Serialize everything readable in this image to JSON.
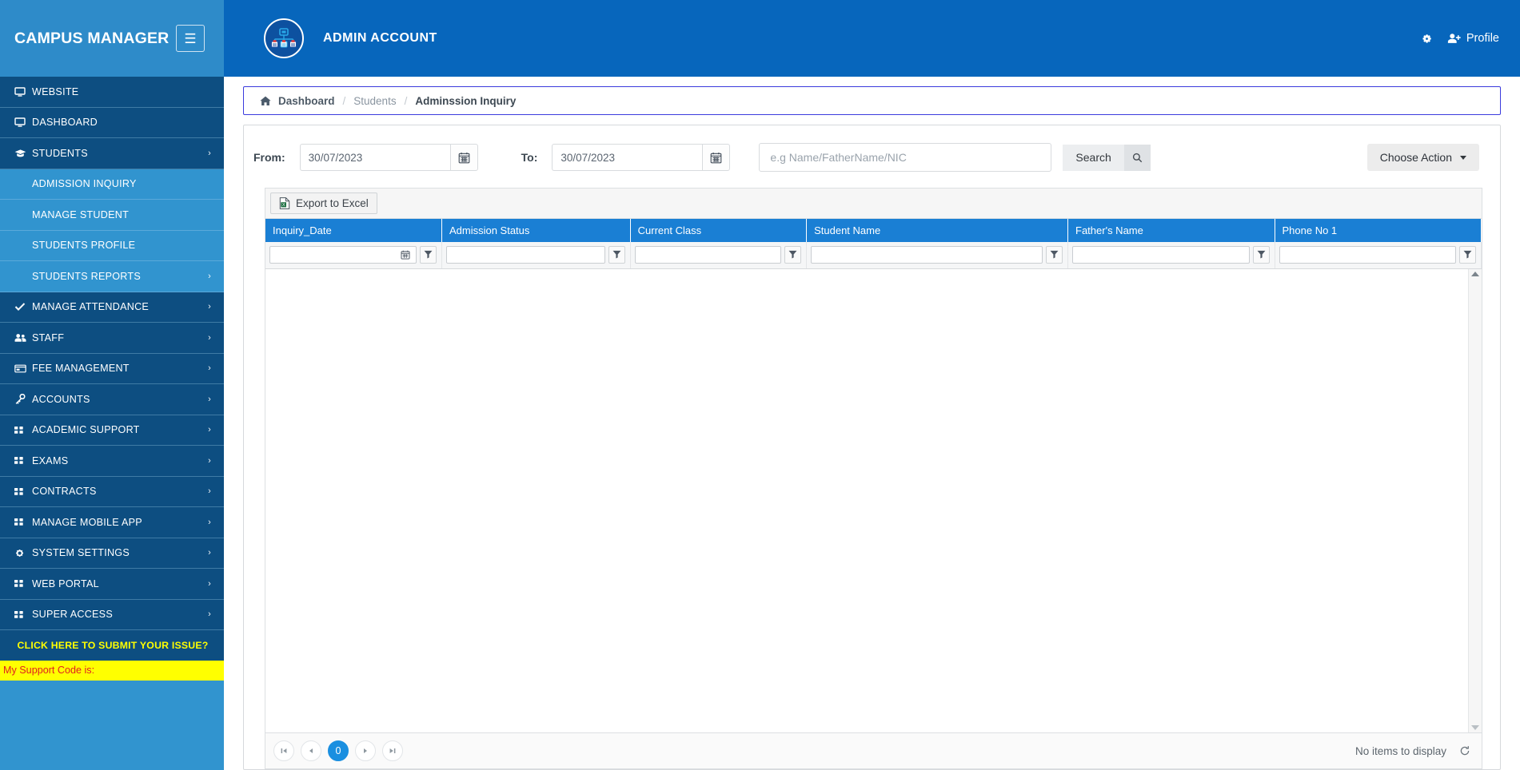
{
  "brand": {
    "title": "CAMPUS MANAGER",
    "menu_icon": "hamburger-icon"
  },
  "sidebar": {
    "items": [
      {
        "label": "WEBSITE",
        "icon": "monitor-icon",
        "caret": "",
        "level": "top"
      },
      {
        "label": "DASHBOARD",
        "icon": "monitor-icon",
        "caret": "",
        "level": "top"
      },
      {
        "label": "STUDENTS",
        "icon": "graduation-cap-icon",
        "caret": "›",
        "level": "top"
      },
      {
        "label": "ADMISSION INQUIRY",
        "icon": "",
        "caret": "",
        "level": "sub"
      },
      {
        "label": "MANAGE STUDENT",
        "icon": "",
        "caret": "",
        "level": "sub"
      },
      {
        "label": "STUDENTS PROFILE",
        "icon": "",
        "caret": "",
        "level": "sub"
      },
      {
        "label": "STUDENTS REPORTS",
        "icon": "",
        "caret": "›",
        "level": "sub"
      },
      {
        "label": "MANAGE ATTENDANCE",
        "icon": "check-icon",
        "caret": "›",
        "level": "top"
      },
      {
        "label": "STAFF",
        "icon": "users-icon",
        "caret": "›",
        "level": "top"
      },
      {
        "label": "FEE MANAGEMENT",
        "icon": "credit-card-icon",
        "caret": "›",
        "level": "top"
      },
      {
        "label": "ACCOUNTS",
        "icon": "key-icon",
        "caret": "›",
        "level": "top"
      },
      {
        "label": "ACADEMIC SUPPORT",
        "icon": "grid-icon",
        "caret": "›",
        "level": "top"
      },
      {
        "label": "EXAMS",
        "icon": "grid-icon",
        "caret": "›",
        "level": "top"
      },
      {
        "label": "CONTRACTS",
        "icon": "grid-icon",
        "caret": "›",
        "level": "top"
      },
      {
        "label": "MANAGE MOBILE APP",
        "icon": "grid-icon",
        "caret": "›",
        "level": "top"
      },
      {
        "label": "SYSTEM SETTINGS",
        "icon": "gear-icon",
        "caret": "›",
        "level": "top"
      },
      {
        "label": "WEB PORTAL",
        "icon": "grid-icon",
        "caret": "›",
        "level": "top"
      },
      {
        "label": "SUPER ACCESS",
        "icon": "grid-icon",
        "caret": "›",
        "level": "top"
      }
    ],
    "issue_link": "CLICK HERE TO SUBMIT YOUR ISSUE?",
    "support_code": "My Support Code is:"
  },
  "topbar": {
    "logo_icon": "org-chart-badge-icon",
    "account_title": "ADMIN ACCOUNT",
    "settings_icon": "gear-icon",
    "profile_icon": "user-plus-icon",
    "profile_label": "Profile"
  },
  "breadcrumb": {
    "home_icon": "home-icon",
    "item1": "Dashboard",
    "sep1": "/",
    "item2": "Students",
    "sep2": "/",
    "item3": "Adminssion Inquiry"
  },
  "filters": {
    "from_label": "From:",
    "from_value": "30/07/2023",
    "to_label": "To:",
    "to_value": "30/07/2023",
    "calendar_icon": "calendar-icon",
    "search_placeholder": "e.g Name/FatherName/NIC",
    "search_value": "",
    "search_label": "Search",
    "search_icon": "magnifier-icon",
    "choose_action_label": "Choose Action",
    "choose_action_caret": "chevron-down-icon"
  },
  "grid": {
    "export_label": "Export to Excel",
    "export_icon": "excel-file-icon",
    "filter_icon": "funnel-icon",
    "columns": [
      {
        "label": "Inquiry_Date",
        "filter_value": "",
        "has_calendar": true
      },
      {
        "label": "Admission Status",
        "filter_value": "",
        "has_calendar": false
      },
      {
        "label": "Current Class",
        "filter_value": "",
        "has_calendar": false
      },
      {
        "label": "Student Name",
        "filter_value": "",
        "has_calendar": false
      },
      {
        "label": "Father's Name",
        "filter_value": "",
        "has_calendar": false
      },
      {
        "label": "Phone No 1",
        "filter_value": "",
        "has_calendar": false
      }
    ],
    "rows": []
  },
  "pager": {
    "first_icon": "first-page-icon",
    "prev_icon": "prev-page-icon",
    "current_page": "0",
    "next_icon": "next-page-icon",
    "last_icon": "last-page-icon",
    "status": "No items to display",
    "refresh_icon": "refresh-icon"
  },
  "colors": {
    "brand_blue": "#2e8bc9",
    "nav_dark": "#0d4e81",
    "nav_sub": "#3194cf",
    "header_blue": "#0766bc",
    "grid_header": "#1a7fd4",
    "accent_yellow": "#ffff00",
    "support_red": "#e02020",
    "page_active": "#1a8fe0"
  }
}
